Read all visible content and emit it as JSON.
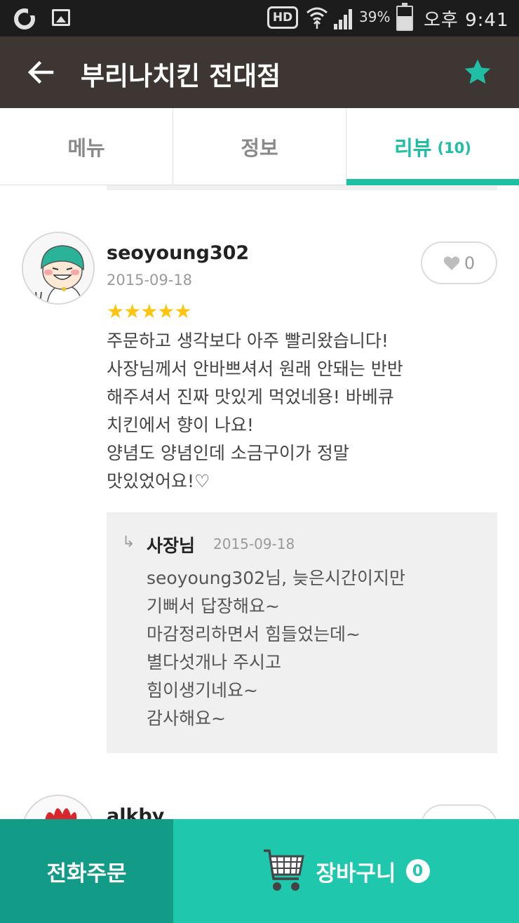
{
  "status_bar": {
    "hd_label": "HD",
    "battery_percent": "39%",
    "battery_level": 0.39,
    "time": "오후 9:41"
  },
  "header": {
    "title": "부리나치킨 전대점",
    "accent_color": "#1fbfa6"
  },
  "tabs": [
    {
      "label": "메뉴",
      "active": false
    },
    {
      "label": "정보",
      "active": false
    },
    {
      "label": "리뷰",
      "count": "(10)",
      "active": true
    }
  ],
  "reviews": [
    {
      "username": "seoyoung302",
      "date": "2015-09-18",
      "likes": "0",
      "rating": 5,
      "stars": "★★★★★",
      "text_lines": [
        "주문하고 생각보다 아주 빨리왔습니다!",
        "사장님께서 안바쁘셔서 원래 안돼는 반반",
        "해주셔서 진짜 맛있게 먹었네용! 바베큐",
        "치킨에서 향이 나요!",
        "양념도 양념인데 소금구이가 정말",
        "맛있었어요!♡"
      ],
      "reply": {
        "arrow": "↳",
        "author": "사장님",
        "date": "2015-09-18",
        "text_lines": [
          "seoyoung302님, 늦은시간이지만",
          "기뻐서 답장해요~",
          "마감정리하면서 힘들었는데~",
          "별다섯개나 주시고",
          "힘이생기네요~",
          "감사해요~"
        ]
      }
    },
    {
      "username": "alkby"
    }
  ],
  "bottom_bar": {
    "call_label": "전화주문",
    "cart_label": "장바구니",
    "cart_count": "0"
  }
}
